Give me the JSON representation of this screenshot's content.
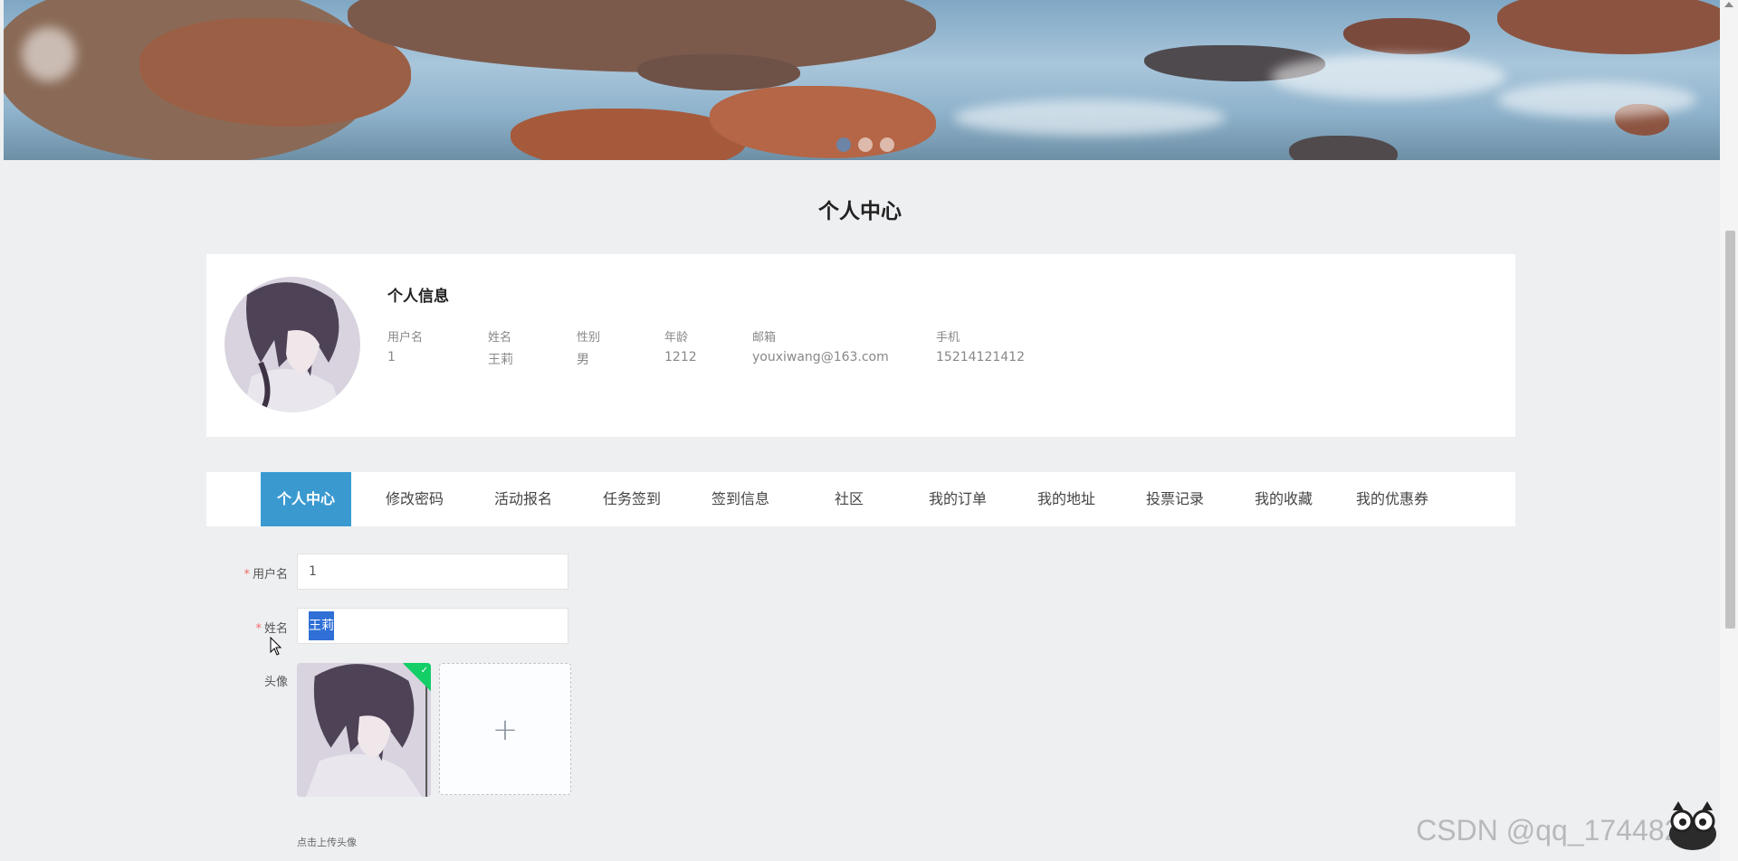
{
  "banner": {
    "dots": 3,
    "active_dot": 0
  },
  "page_title": "个人中心",
  "profile": {
    "title": "个人信息",
    "fields": [
      {
        "label": "用户名",
        "value": "1"
      },
      {
        "label": "姓名",
        "value": "王莉"
      },
      {
        "label": "性别",
        "value": "男"
      },
      {
        "label": "年龄",
        "value": "1212"
      },
      {
        "label": "邮箱",
        "value": "youxiwang@163.com"
      },
      {
        "label": "手机",
        "value": "15214121412"
      }
    ]
  },
  "tabs": [
    {
      "label": "个人中心",
      "active": true
    },
    {
      "label": "修改密码"
    },
    {
      "label": "活动报名"
    },
    {
      "label": "任务签到"
    },
    {
      "label": "签到信息"
    },
    {
      "label": "社区"
    },
    {
      "label": "我的订单"
    },
    {
      "label": "我的地址"
    },
    {
      "label": "投票记录"
    },
    {
      "label": "我的收藏"
    },
    {
      "label": "我的优惠券"
    }
  ],
  "form": {
    "username": {
      "label": "用户名",
      "value": "1"
    },
    "name": {
      "label": "姓名",
      "value": "王莉"
    },
    "avatar": {
      "label": "头像",
      "hint": "点击上传头像"
    }
  },
  "watermark": "CSDN @qq_17448281",
  "colors": {
    "accent": "#3a9ad0",
    "success": "#13ce66",
    "required": "#f56c6c"
  }
}
